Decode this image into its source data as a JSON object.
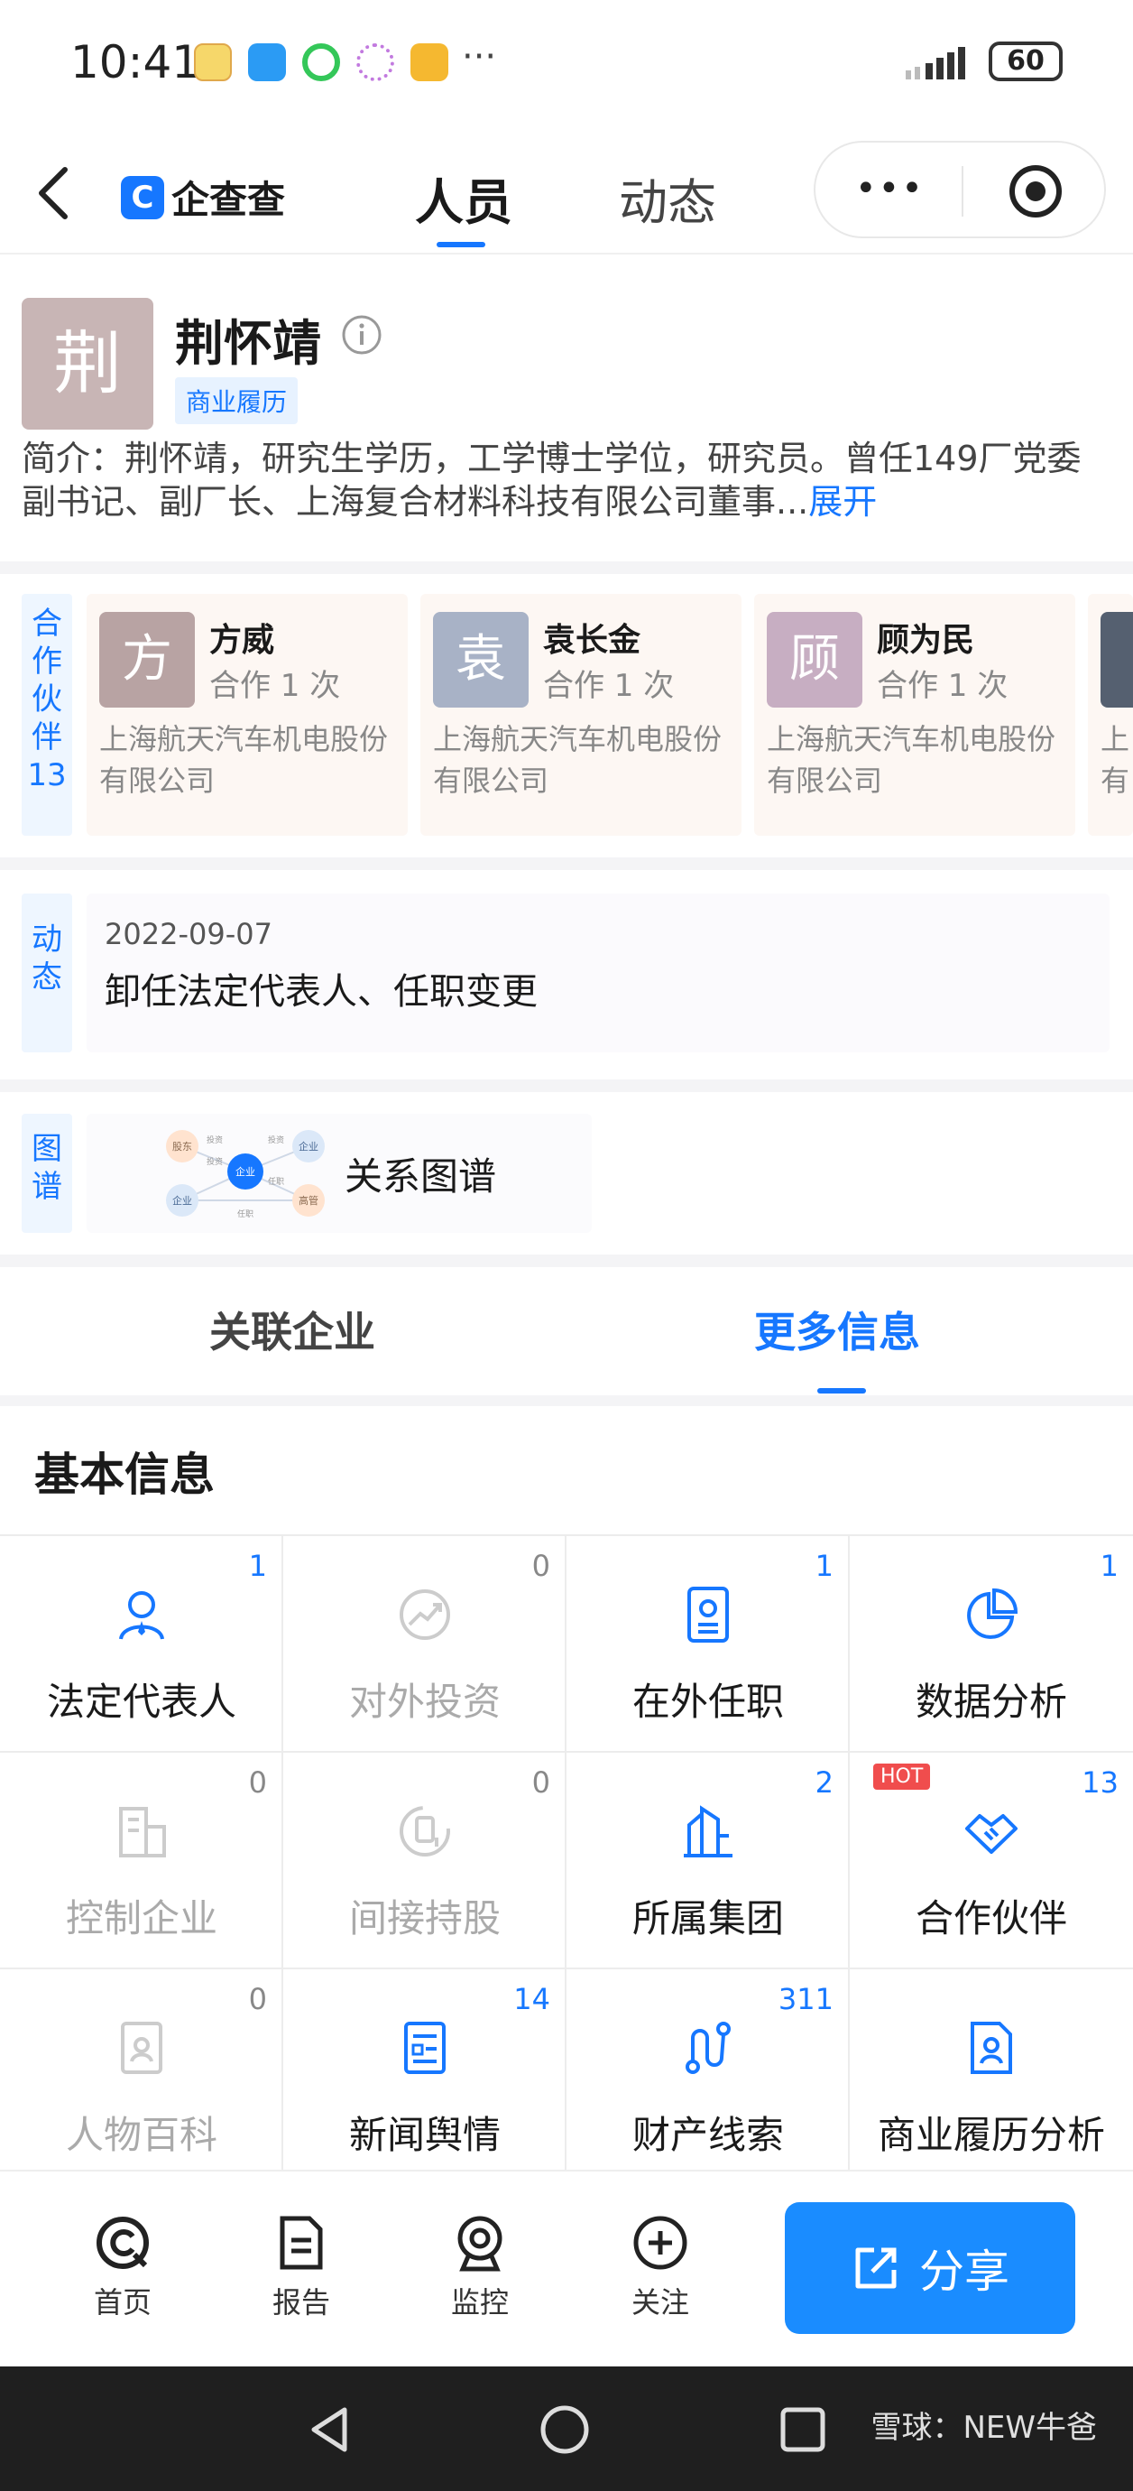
{
  "status": {
    "time": "10:41",
    "more": "···",
    "battery": "60"
  },
  "nav": {
    "brand": "企查查",
    "brand_mark": "C",
    "tab_people": "人员",
    "tab_dynamic": "动态",
    "capsule_menu": "•••"
  },
  "profile": {
    "avatar_char": "荆",
    "name": "荆怀靖",
    "badge": "商业履历",
    "intro": "简介：荆怀靖，研究生学历，工学博士学位，研究员。曾任149厂党委副书记、副厂长、上海复合材料科技有限公司董事...",
    "expand": "展开"
  },
  "partners": {
    "label": "合作伙伴13",
    "label_chars": [
      "合",
      "作",
      "伙",
      "伴",
      "13"
    ],
    "items": [
      {
        "avatar": "方",
        "name": "方威",
        "count": "合作 1 次",
        "company": "上海航天汽车机电股份有限公司",
        "color": "#b8a3a3"
      },
      {
        "avatar": "袁",
        "name": "袁长金",
        "count": "合作 1 次",
        "company": "上海航天汽车机电股份有限公司",
        "color": "#a8b2c6"
      },
      {
        "avatar": "顾",
        "name": "顾为民",
        "count": "合作 1 次",
        "company": "上海航天汽车机电股份有限公司",
        "color": "#c7aec2"
      }
    ],
    "partial_company": "上有"
  },
  "dynamic": {
    "label_chars": [
      "动",
      "态"
    ],
    "date": "2022-09-07",
    "text": "卸任法定代表人、任职变更"
  },
  "graph": {
    "label_chars": [
      "图",
      "谱"
    ],
    "title": "关系图谱",
    "nodes": [
      "股东",
      "投资",
      "投资",
      "企业",
      "企业",
      "任职",
      "企业",
      "高管",
      "投资",
      "任职"
    ]
  },
  "tabs": {
    "assoc": "关联企业",
    "more": "更多信息"
  },
  "section": {
    "title": "基本信息"
  },
  "grid": [
    {
      "label": "法定代表人",
      "count": "1",
      "active": true,
      "icon": "person-icon"
    },
    {
      "label": "对外投资",
      "count": "0",
      "active": false,
      "icon": "investment-icon"
    },
    {
      "label": "在外任职",
      "count": "1",
      "active": true,
      "icon": "badge-icon"
    },
    {
      "label": "数据分析",
      "count": "1",
      "active": true,
      "icon": "pie-chart-icon"
    },
    {
      "label": "控制企业",
      "count": "0",
      "active": false,
      "icon": "building-icon"
    },
    {
      "label": "间接持股",
      "count": "0",
      "active": false,
      "icon": "shares-icon"
    },
    {
      "label": "所属集团",
      "count": "2",
      "active": true,
      "icon": "group-icon"
    },
    {
      "label": "合作伙伴",
      "count": "13",
      "active": true,
      "icon": "handshake-icon",
      "hot": "HOT"
    },
    {
      "label": "人物百科",
      "count": "0",
      "active": false,
      "icon": "encyclopedia-icon"
    },
    {
      "label": "新闻舆情",
      "count": "14",
      "active": true,
      "icon": "news-icon"
    },
    {
      "label": "财产线索",
      "count": "311",
      "active": true,
      "icon": "route-icon"
    },
    {
      "label": "商业履历分析",
      "count": "",
      "active": true,
      "icon": "resume-icon"
    }
  ],
  "bottom": {
    "home": "首页",
    "report": "报告",
    "monitor": "监控",
    "follow": "关注",
    "share": "分享"
  },
  "watermark": "雪球：NEW牛爸",
  "colors": {
    "accent": "#1677ff",
    "hot": "#f04d4d"
  }
}
